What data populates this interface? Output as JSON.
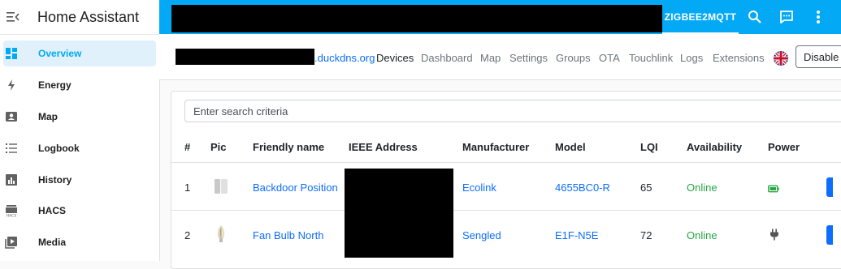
{
  "sidebar": {
    "title": "Home Assistant",
    "items": [
      {
        "label": "Overview",
        "icon": "overview-icon"
      },
      {
        "label": "Energy",
        "icon": "energy-icon"
      },
      {
        "label": "Map",
        "icon": "map-icon"
      },
      {
        "label": "Logbook",
        "icon": "logbook-icon"
      },
      {
        "label": "History",
        "icon": "history-icon"
      },
      {
        "label": "HACS",
        "icon": "hacs-icon"
      },
      {
        "label": "Media",
        "icon": "media-icon"
      }
    ]
  },
  "topbar": {
    "tab_label": "ZIGBEE2MQTT",
    "icons": [
      "search-icon",
      "chat-icon",
      "more-vert-icon"
    ]
  },
  "nav": {
    "host": ".duckdns.org",
    "links": [
      "Devices",
      "Dashboard",
      "Map",
      "Settings",
      "Groups",
      "OTA",
      "Touchlink",
      "Logs",
      "Extensions"
    ],
    "active": "Devices",
    "language_icon": "uk-flag-icon",
    "disable_join_label": "Disable join"
  },
  "search": {
    "placeholder": "Enter search criteria"
  },
  "table": {
    "headers": [
      "#",
      "Pic",
      "Friendly name",
      "IEEE Address",
      "Manufacturer",
      "Model",
      "LQI",
      "Availability",
      "Power"
    ],
    "rows": [
      {
        "num": "1",
        "pic": "door-sensor-pic",
        "friendly_name": "Backdoor Position",
        "manufacturer": "Ecolink",
        "model": "4655BC0-R",
        "lqi": "65",
        "availability": "Online",
        "power": "battery-icon"
      },
      {
        "num": "2",
        "pic": "bulb-pic",
        "friendly_name": "Fan Bulb North",
        "manufacturer": "Sengled",
        "model": "E1F-N5E",
        "lqi": "72",
        "availability": "Online",
        "power": "plug-icon"
      }
    ]
  },
  "colors": {
    "accent": "#03a9f4",
    "sidebar_active_bg": "#e1f1fb",
    "link": "#0d6efd",
    "online": "#28a745"
  }
}
